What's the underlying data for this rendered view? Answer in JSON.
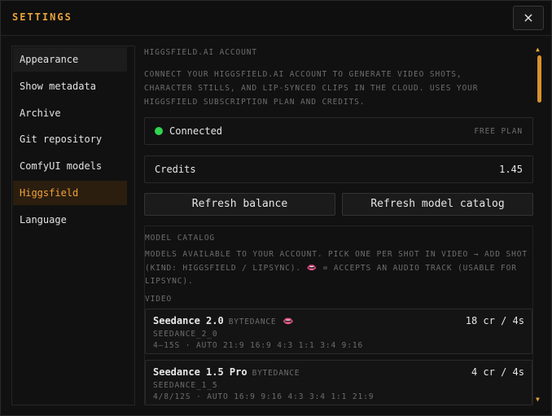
{
  "header": {
    "title": "SETTINGS",
    "close_icon": "×"
  },
  "sidebar": {
    "items": [
      {
        "label": "Appearance"
      },
      {
        "label": "Show metadata"
      },
      {
        "label": "Archive"
      },
      {
        "label": "Git repository"
      },
      {
        "label": "ComfyUI models"
      },
      {
        "label": "Higgsfield"
      },
      {
        "label": "Language"
      }
    ]
  },
  "account": {
    "title": "HIGGSFIELD.AI ACCOUNT",
    "description": "CONNECT YOUR HIGGSFIELD.AI ACCOUNT TO GENERATE VIDEO SHOTS, CHARACTER STILLS, AND LIP-SYNCED CLIPS IN THE CLOUD. USES YOUR HIGGSFIELD SUBSCRIPTION PLAN AND CREDITS.",
    "status": "Connected",
    "status_color": "#2fd64e",
    "plan": "FREE PLAN",
    "credits_label": "Credits",
    "credits_value": "1.45",
    "refresh_balance": "Refresh balance",
    "refresh_catalog": "Refresh model catalog"
  },
  "catalog": {
    "title": "MODEL CATALOG",
    "desc_part1": "MODELS AVAILABLE TO YOUR ACCOUNT. PICK ONE PER SHOT IN VIDEO → ADD SHOT (KIND: HIGGSFIELD / LIPSYNC).",
    "lips_glyph": "👄",
    "desc_part2": "= ACCEPTS AN AUDIO TRACK (USABLE FOR LIPSYNC).",
    "video_label": "VIDEO",
    "models": [
      {
        "name": "Seedance 2.0",
        "vendor": "BYTEDANCE",
        "lipsync": "👄",
        "price": "18 cr / 4s",
        "id": "SEEDANCE_2_0",
        "spec": "4–15S · AUTO 21:9 16:9 4:3 1:1 3:4 9:16"
      },
      {
        "name": "Seedance 1.5 Pro",
        "vendor": "BYTEDANCE",
        "lipsync": "",
        "price": "4 cr / 4s",
        "id": "SEEDANCE_1_5",
        "spec": "4/8/12S · AUTO 16:9 9:16 4:3 3:4 1:1 21:9"
      }
    ]
  },
  "colors": {
    "accent": "#e8a33a",
    "active_bg": "#2b1e0f"
  }
}
